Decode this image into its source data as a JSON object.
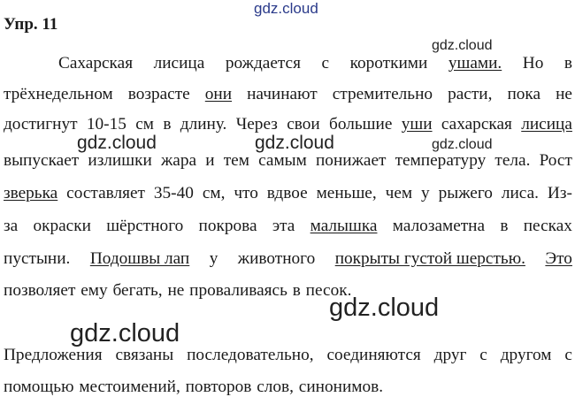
{
  "watermarks": {
    "top": "gdz.cloud",
    "right_1": "gdz.cloud",
    "left_mid": "gdz.cloud",
    "center_mid": "gdz.cloud",
    "right_2": "gdz.cloud",
    "center_big": "gdz.cloud",
    "left_big": "gdz.cloud"
  },
  "exercise": {
    "title": "Упр. 11",
    "lines": [
      [
        "Сахарская",
        "лисица",
        "рождается",
        "с",
        "короткими",
        "ушами.",
        "Но",
        "в"
      ],
      [
        "трёхнедельном",
        "возрасте",
        "они",
        "начинают",
        "стремительно",
        "расти,",
        "пока",
        "не"
      ],
      [
        "достигнут",
        "10-15",
        "см",
        "в",
        "длину.",
        "Через",
        "свои",
        "большие",
        "уши",
        "сахарская",
        "лисица"
      ],
      [
        "выпускает",
        "излишки",
        "жара",
        "и",
        "тем",
        "самым",
        "понижает",
        "температуру",
        "тела.",
        "Рост"
      ],
      [
        "зверька",
        "составляет",
        "35-40",
        "см,",
        "что",
        "вдвое",
        "меньше,",
        "чем",
        "у",
        "рыжего",
        "лиса.",
        "Из-"
      ],
      [
        "за",
        "окраски",
        "шёрстного",
        "покрова",
        "эта",
        "малышка",
        "малозаметна",
        "в",
        "песках"
      ],
      [
        "пустыни.",
        "Подошвы лап",
        "у",
        "животного",
        "покрыты густой шерстью.",
        "Это"
      ],
      [
        "позволяет",
        "ему",
        "бегать,",
        "не",
        "проваливаясь",
        "в",
        "песок."
      ]
    ],
    "conclusion": [
      [
        "Предложения",
        "связаны",
        "последовательно,",
        "соединяются",
        "друг",
        "с",
        "другом",
        "с"
      ],
      [
        "помощью",
        "местоимений,",
        "повторов",
        "слов,",
        "синонимов."
      ]
    ]
  }
}
